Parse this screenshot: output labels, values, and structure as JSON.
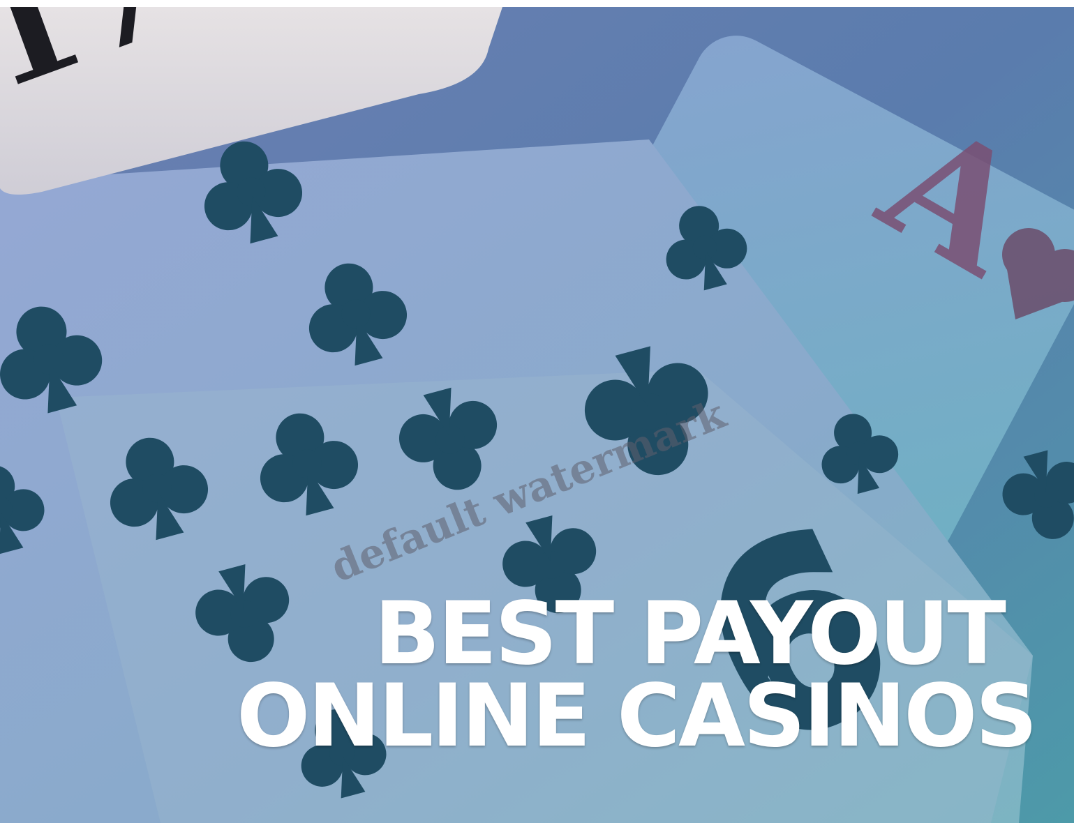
{
  "image": {
    "description_icon": "playing-cards-photo"
  },
  "headline": {
    "line1": "BEST PAYOUT",
    "line2": "ONLINE CASINOS"
  },
  "watermark": {
    "text": "default watermark"
  },
  "colors": {
    "card_blue": "#8fa6d4",
    "card_teal": "#7fb3c4",
    "club_dark": "#1f4c63",
    "ace_red": "#7a4f73",
    "headline_text": "#ffffff",
    "watermark_text": "#5f5f6e"
  }
}
